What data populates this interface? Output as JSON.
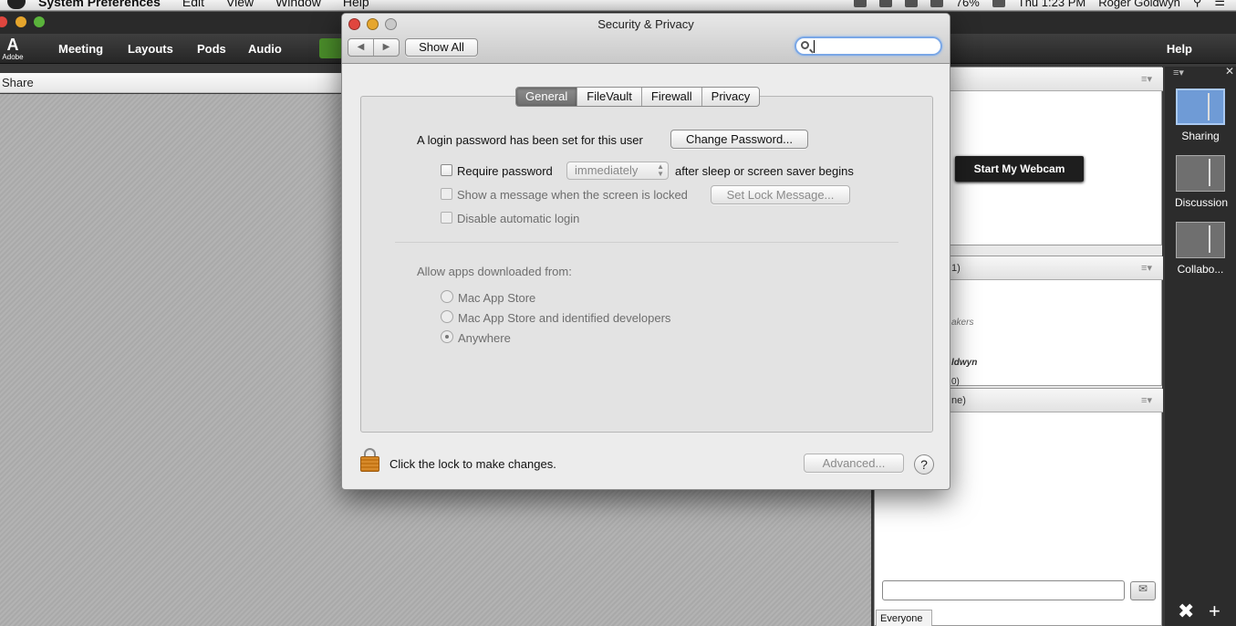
{
  "menubar": {
    "app": "System Preferences",
    "items": [
      "Edit",
      "View",
      "Window",
      "Help"
    ],
    "status": {
      "battery": "76%",
      "clock": "Thu 1:23 PM",
      "user": "Roger Goldwyn"
    }
  },
  "adobe": {
    "logo_text": "Adobe",
    "nav": [
      "Meeting",
      "Layouts",
      "Pods",
      "Audio"
    ],
    "help": "Help",
    "share_title": "Share",
    "webcam_button": "Start My Webcam",
    "attendees_header": "1)",
    "speakers_label": "akers",
    "attendee_name": "ldwyn",
    "attendee_count": "0)",
    "chat_header": "ne)",
    "chat_scope": "Everyone",
    "layouts": [
      {
        "label": "Sharing",
        "selected": true
      },
      {
        "label": "Discussion",
        "selected": false
      },
      {
        "label": "Collabo...",
        "selected": false
      }
    ]
  },
  "window": {
    "title": "Security & Privacy",
    "show_all": "Show All",
    "search_placeholder": "",
    "tabs": [
      "General",
      "FileVault",
      "Firewall",
      "Privacy"
    ],
    "active_tab": "General",
    "login_password_text": "A login password has been set for this user",
    "change_password": "Change Password...",
    "require_password": "Require password",
    "require_password_delay": "immediately",
    "after_sleep": "after sleep or screen saver begins",
    "show_message": "Show a message when the screen is locked",
    "set_lock_message": "Set Lock Message...",
    "disable_auto_login": "Disable automatic login",
    "allow_apps_label": "Allow apps downloaded from:",
    "allow_options": [
      "Mac App Store",
      "Mac App Store and identified developers",
      "Anywhere"
    ],
    "allow_selected": "Anywhere",
    "lock_text": "Click the lock to make changes.",
    "advanced": "Advanced...",
    "help_glyph": "?"
  },
  "colors": {
    "accent_search_ring": "#7aa7e6",
    "active_tab": "#7d7d7d",
    "webcam_button": "#1e1e1e",
    "layout_selected": "#6f9bd6"
  }
}
